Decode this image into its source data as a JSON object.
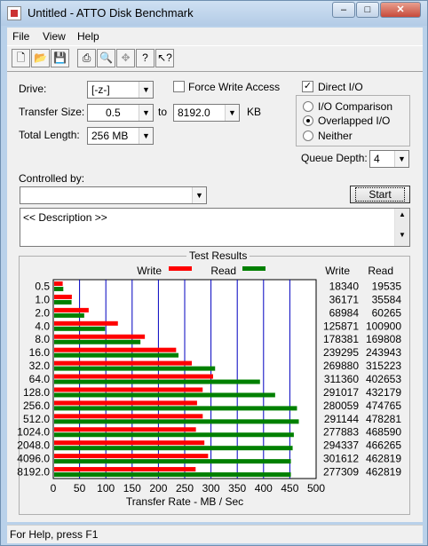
{
  "window": {
    "title": "Untitled - ATTO Disk Benchmark"
  },
  "menu": [
    "File",
    "View",
    "Help"
  ],
  "toolbar_icons": [
    "new-icon",
    "open-icon",
    "save-icon",
    "print-icon",
    "print-preview-icon",
    "move-icon",
    "help-icon",
    "context-help-icon"
  ],
  "settings": {
    "drive_label": "Drive:",
    "drive_value": "[-z-]",
    "force_write_label": "Force Write Access",
    "direct_io_label": "Direct I/O",
    "transfer_size_label": "Transfer Size:",
    "transfer_from": "0.5",
    "to_label": "to",
    "transfer_to": "8192.0",
    "kb_label": "KB",
    "total_length_label": "Total Length:",
    "total_length_value": "256 MB",
    "io_comparison_label": "I/O Comparison",
    "overlapped_io_label": "Overlapped I/O",
    "neither_label": "Neither",
    "queue_depth_label": "Queue Depth:",
    "queue_depth_value": "4",
    "controlled_by_label": "Controlled by:",
    "controlled_by_value": "",
    "start_label": "Start",
    "description": "<< Description >>"
  },
  "status_text": "For Help, press F1",
  "chart_data": {
    "type": "bar",
    "title": "Test Results",
    "xlabel": "Transfer Rate - MB / Sec",
    "xlim": [
      0,
      500
    ],
    "xticks": [
      0,
      50,
      100,
      150,
      200,
      250,
      300,
      350,
      400,
      450,
      500
    ],
    "categories": [
      "0.5",
      "1.0",
      "2.0",
      "4.0",
      "8.0",
      "16.0",
      "32.0",
      "64.0",
      "128.0",
      "256.0",
      "512.0",
      "1024.0",
      "2048.0",
      "4096.0",
      "8192.0"
    ],
    "legend": {
      "write": "Write",
      "read": "Read"
    },
    "series": [
      {
        "name": "Write",
        "color": "#ff0000",
        "values": [
          18340,
          36171,
          68984,
          125871,
          178381,
          239295,
          269880,
          311360,
          291017,
          280059,
          291144,
          277883,
          294337,
          301612,
          277309
        ]
      },
      {
        "name": "Read",
        "color": "#008000",
        "values": [
          19535,
          35584,
          60265,
          100900,
          169808,
          243943,
          315223,
          402653,
          432179,
          474765,
          478281,
          468590,
          466265,
          462819,
          462819
        ]
      }
    ],
    "column_headers": [
      "Write",
      "Read"
    ]
  }
}
